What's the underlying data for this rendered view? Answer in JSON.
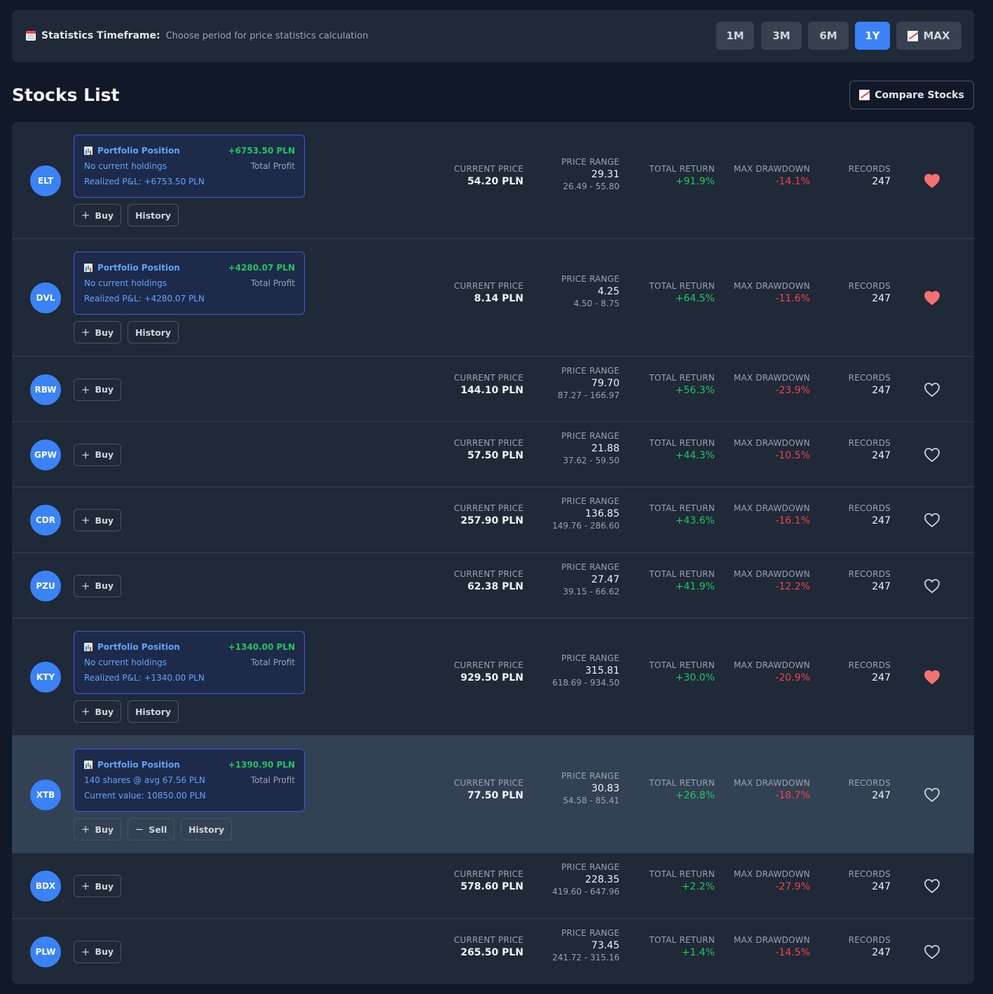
{
  "timeframe": {
    "title": "Statistics Timeframe:",
    "subtitle": "Choose period for price statistics calculation",
    "options": [
      "1M",
      "3M",
      "6M",
      "1Y",
      "MAX"
    ],
    "active": "1Y"
  },
  "page_title": "Stocks List",
  "compare_label": "Compare Stocks",
  "labels": {
    "current_price": "CURRENT PRICE",
    "price_range": "PRICE RANGE",
    "total_return": "TOTAL RETURN",
    "max_drawdown": "MAX DRAWDOWN",
    "records": "RECORDS",
    "portfolio_position": "Portfolio Position",
    "total_profit": "Total Profit",
    "buy": "Buy",
    "sell": "Sell",
    "history": "History"
  },
  "colors": {
    "accent": "#3b82f6",
    "positive": "#22c55e",
    "negative": "#ef4444",
    "favorite": "#f87171"
  },
  "stocks": [
    {
      "ticker": "ELT",
      "position": {
        "profit": "+6753.50 PLN",
        "line2": "No current holdings",
        "line3": "Realized P&L: +6753.50 PLN"
      },
      "buttons": [
        "Buy",
        "History"
      ],
      "current_price": "54.20 PLN",
      "range_value": "29.31",
      "range_span": "26.49 - 55.80",
      "total_return": "+91.9%",
      "max_drawdown": "-14.1%",
      "records": "247",
      "favorite": true
    },
    {
      "ticker": "DVL",
      "position": {
        "profit": "+4280.07 PLN",
        "line2": "No current holdings",
        "line3": "Realized P&L: +4280.07 PLN"
      },
      "buttons": [
        "Buy",
        "History"
      ],
      "current_price": "8.14 PLN",
      "range_value": "4.25",
      "range_span": "4.50 - 8.75",
      "total_return": "+64.5%",
      "max_drawdown": "-11.6%",
      "records": "247",
      "favorite": true
    },
    {
      "ticker": "RBW",
      "buttons": [
        "Buy"
      ],
      "current_price": "144.10 PLN",
      "range_value": "79.70",
      "range_span": "87.27 - 166.97",
      "total_return": "+56.3%",
      "max_drawdown": "-23.9%",
      "records": "247",
      "favorite": false
    },
    {
      "ticker": "GPW",
      "buttons": [
        "Buy"
      ],
      "current_price": "57.50 PLN",
      "range_value": "21.88",
      "range_span": "37.62 - 59.50",
      "total_return": "+44.3%",
      "max_drawdown": "-10.5%",
      "records": "247",
      "favorite": false
    },
    {
      "ticker": "CDR",
      "buttons": [
        "Buy"
      ],
      "current_price": "257.90 PLN",
      "range_value": "136.85",
      "range_span": "149.76 - 286.60",
      "total_return": "+43.6%",
      "max_drawdown": "-16.1%",
      "records": "247",
      "favorite": false
    },
    {
      "ticker": "PZU",
      "buttons": [
        "Buy"
      ],
      "current_price": "62.38 PLN",
      "range_value": "27.47",
      "range_span": "39.15 - 66.62",
      "total_return": "+41.9%",
      "max_drawdown": "-12.2%",
      "records": "247",
      "favorite": false
    },
    {
      "ticker": "KTY",
      "position": {
        "profit": "+1340.00 PLN",
        "line2": "No current holdings",
        "line3": "Realized P&L: +1340.00 PLN"
      },
      "buttons": [
        "Buy",
        "History"
      ],
      "current_price": "929.50 PLN",
      "range_value": "315.81",
      "range_span": "618.69 - 934.50",
      "total_return": "+30.0%",
      "max_drawdown": "-20.9%",
      "records": "247",
      "favorite": true
    },
    {
      "ticker": "XTB",
      "position": {
        "profit": "+1390.90 PLN",
        "line2": "140 shares @ avg 67.56 PLN",
        "line3": "Current value: 10850.00 PLN"
      },
      "buttons": [
        "Buy",
        "Sell",
        "History"
      ],
      "current_price": "77.50 PLN",
      "range_value": "30.83",
      "range_span": "54.58 - 85.41",
      "total_return": "+26.8%",
      "max_drawdown": "-18.7%",
      "records": "247",
      "favorite": false,
      "highlighted": true
    },
    {
      "ticker": "BDX",
      "buttons": [
        "Buy"
      ],
      "current_price": "578.60 PLN",
      "range_value": "228.35",
      "range_span": "419.60 - 647.96",
      "total_return": "+2.2%",
      "max_drawdown": "-27.9%",
      "records": "247",
      "favorite": false
    },
    {
      "ticker": "PLW",
      "buttons": [
        "Buy"
      ],
      "current_price": "265.50 PLN",
      "range_value": "73.45",
      "range_span": "241.72 - 315.16",
      "total_return": "+1.4%",
      "max_drawdown": "-14.5%",
      "records": "247",
      "favorite": false
    }
  ]
}
